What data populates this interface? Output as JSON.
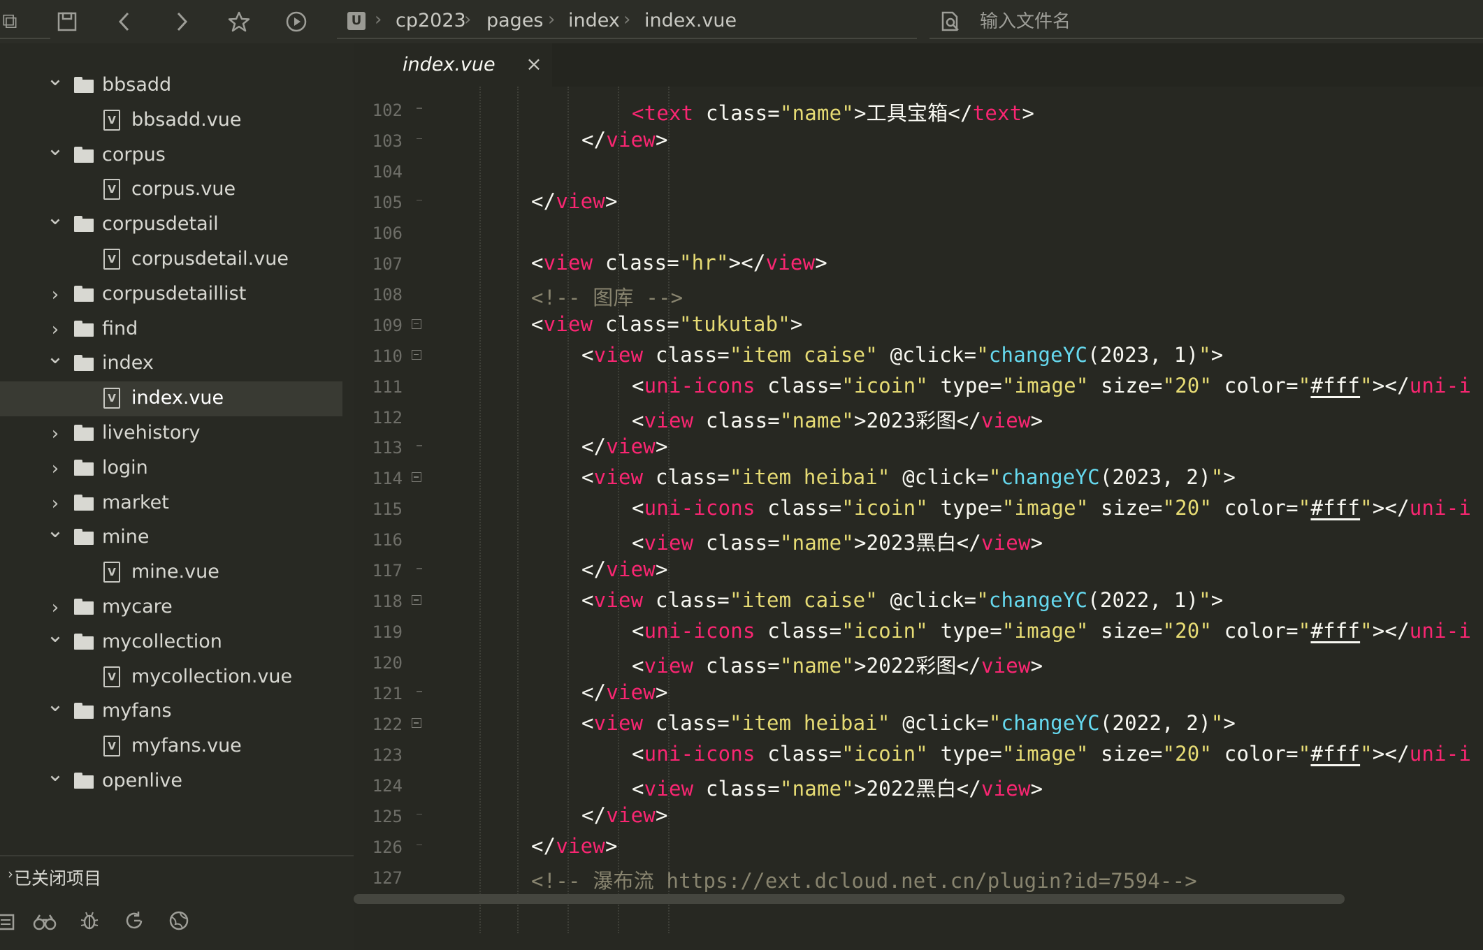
{
  "toolbar": {
    "search_placeholder": "输入文件名",
    "breadcrumb": [
      "cp2023",
      "pages",
      "index",
      "index.vue"
    ],
    "breadcrumb_logo": "U"
  },
  "sidebar": {
    "tree": [
      {
        "label": "bbsadd",
        "kind": "folder",
        "expanded": true,
        "depth": 0
      },
      {
        "label": "bbsadd.vue",
        "kind": "file",
        "depth": 1
      },
      {
        "label": "corpus",
        "kind": "folder",
        "expanded": true,
        "depth": 0
      },
      {
        "label": "corpus.vue",
        "kind": "file",
        "depth": 1
      },
      {
        "label": "corpusdetail",
        "kind": "folder",
        "expanded": true,
        "depth": 0
      },
      {
        "label": "corpusdetail.vue",
        "kind": "file",
        "depth": 1
      },
      {
        "label": "corpusdetaillist",
        "kind": "folder",
        "expanded": false,
        "depth": 0
      },
      {
        "label": "find",
        "kind": "folder",
        "expanded": false,
        "depth": 0
      },
      {
        "label": "index",
        "kind": "folder",
        "expanded": true,
        "depth": 0
      },
      {
        "label": "index.vue",
        "kind": "file",
        "depth": 1,
        "selected": true
      },
      {
        "label": "livehistory",
        "kind": "folder",
        "expanded": false,
        "depth": 0
      },
      {
        "label": "login",
        "kind": "folder",
        "expanded": false,
        "depth": 0
      },
      {
        "label": "market",
        "kind": "folder",
        "expanded": false,
        "depth": 0
      },
      {
        "label": "mine",
        "kind": "folder",
        "expanded": true,
        "depth": 0
      },
      {
        "label": "mine.vue",
        "kind": "file",
        "depth": 1
      },
      {
        "label": "mycare",
        "kind": "folder",
        "expanded": false,
        "depth": 0
      },
      {
        "label": "mycollection",
        "kind": "folder",
        "expanded": true,
        "depth": 0
      },
      {
        "label": "mycollection.vue",
        "kind": "file",
        "depth": 1
      },
      {
        "label": "myfans",
        "kind": "folder",
        "expanded": true,
        "depth": 0
      },
      {
        "label": "myfans.vue",
        "kind": "file",
        "depth": 1
      },
      {
        "label": "openlive",
        "kind": "folder",
        "expanded": true,
        "depth": 0
      }
    ],
    "closed_projects_label": "已关闭项目",
    "file_icon_letter": "V"
  },
  "editor": {
    "tab_label": "index.vue",
    "tab_close": "×",
    "lines": [
      {
        "n": "102",
        "fold": "end",
        "ind": 3,
        "tokens": [
          [
            "t",
            "<text"
          ],
          [
            "p",
            " "
          ],
          [
            "at",
            "class"
          ],
          [
            "p",
            "="
          ],
          [
            "s",
            "\"name\""
          ],
          [
            "p",
            ">工具宝箱</"
          ],
          [
            "t",
            "text"
          ],
          [
            "p",
            ">"
          ]
        ]
      },
      {
        "n": "103",
        "fold": "end",
        "ind": 2,
        "tokens": [
          [
            "p",
            "</"
          ],
          [
            "t",
            "view"
          ],
          [
            "p",
            ">"
          ]
        ]
      },
      {
        "n": "104",
        "fold": "",
        "ind": 0,
        "tokens": []
      },
      {
        "n": "105",
        "fold": "end",
        "ind": 1,
        "tokens": [
          [
            "p",
            "</"
          ],
          [
            "t",
            "view"
          ],
          [
            "p",
            ">"
          ]
        ]
      },
      {
        "n": "106",
        "fold": "",
        "ind": 0,
        "tokens": []
      },
      {
        "n": "107",
        "fold": "",
        "ind": 1,
        "tokens": [
          [
            "p",
            "<"
          ],
          [
            "t",
            "view"
          ],
          [
            "p",
            " "
          ],
          [
            "at",
            "class"
          ],
          [
            "p",
            "="
          ],
          [
            "s",
            "\"hr\""
          ],
          [
            "p",
            "></"
          ],
          [
            "t",
            "view"
          ],
          [
            "p",
            ">"
          ]
        ]
      },
      {
        "n": "108",
        "fold": "",
        "ind": 1,
        "tokens": [
          [
            "c",
            "<!-- 图库 -->"
          ]
        ]
      },
      {
        "n": "109",
        "fold": "open",
        "ind": 1,
        "tokens": [
          [
            "p",
            "<"
          ],
          [
            "t",
            "view"
          ],
          [
            "p",
            " "
          ],
          [
            "at",
            "class"
          ],
          [
            "p",
            "="
          ],
          [
            "s",
            "\"tukutab\""
          ],
          [
            "p",
            ">"
          ]
        ]
      },
      {
        "n": "110",
        "fold": "open",
        "ind": 2,
        "tokens": [
          [
            "p",
            "<"
          ],
          [
            "t",
            "view"
          ],
          [
            "p",
            " "
          ],
          [
            "at",
            "class"
          ],
          [
            "p",
            "="
          ],
          [
            "s",
            "\"item caise\""
          ],
          [
            "p",
            " "
          ],
          [
            "at",
            "@click"
          ],
          [
            "p",
            "="
          ],
          [
            "s",
            "\""
          ],
          [
            "f",
            "changeYC"
          ],
          [
            "p",
            "(2023, 1)"
          ],
          [
            "s",
            "\""
          ],
          [
            "p",
            ">"
          ]
        ]
      },
      {
        "n": "111",
        "fold": "",
        "ind": 3,
        "tokens": [
          [
            "p",
            "<"
          ],
          [
            "t",
            "uni-icons"
          ],
          [
            "p",
            " "
          ],
          [
            "at",
            "class"
          ],
          [
            "p",
            "="
          ],
          [
            "s",
            "\"icoin\""
          ],
          [
            "p",
            " "
          ],
          [
            "at",
            "type"
          ],
          [
            "p",
            "="
          ],
          [
            "s",
            "\"image\""
          ],
          [
            "p",
            " "
          ],
          [
            "at",
            "size"
          ],
          [
            "p",
            "="
          ],
          [
            "s",
            "\"20\""
          ],
          [
            "p",
            " "
          ],
          [
            "at",
            "color"
          ],
          [
            "p",
            "="
          ],
          [
            "s",
            "\""
          ],
          [
            "u",
            "#fff"
          ],
          [
            "s",
            "\""
          ],
          [
            "p",
            "></"
          ],
          [
            "t",
            "uni-i"
          ]
        ]
      },
      {
        "n": "112",
        "fold": "",
        "ind": 3,
        "tokens": [
          [
            "p",
            "<"
          ],
          [
            "t",
            "view"
          ],
          [
            "p",
            " "
          ],
          [
            "at",
            "class"
          ],
          [
            "p",
            "="
          ],
          [
            "s",
            "\"name\""
          ],
          [
            "p",
            ">2023彩图</"
          ],
          [
            "t",
            "view"
          ],
          [
            "p",
            ">"
          ]
        ]
      },
      {
        "n": "113",
        "fold": "end",
        "ind": 2,
        "tokens": [
          [
            "p",
            "</"
          ],
          [
            "t",
            "view"
          ],
          [
            "p",
            ">"
          ]
        ]
      },
      {
        "n": "114",
        "fold": "open",
        "ind": 2,
        "tokens": [
          [
            "p",
            "<"
          ],
          [
            "t",
            "view"
          ],
          [
            "p",
            " "
          ],
          [
            "at",
            "class"
          ],
          [
            "p",
            "="
          ],
          [
            "s",
            "\"item heibai\""
          ],
          [
            "p",
            " "
          ],
          [
            "at",
            "@click"
          ],
          [
            "p",
            "="
          ],
          [
            "s",
            "\""
          ],
          [
            "f",
            "changeYC"
          ],
          [
            "p",
            "(2023, 2)"
          ],
          [
            "s",
            "\""
          ],
          [
            "p",
            ">"
          ]
        ]
      },
      {
        "n": "115",
        "fold": "",
        "ind": 3,
        "tokens": [
          [
            "p",
            "<"
          ],
          [
            "t",
            "uni-icons"
          ],
          [
            "p",
            " "
          ],
          [
            "at",
            "class"
          ],
          [
            "p",
            "="
          ],
          [
            "s",
            "\"icoin\""
          ],
          [
            "p",
            " "
          ],
          [
            "at",
            "type"
          ],
          [
            "p",
            "="
          ],
          [
            "s",
            "\"image\""
          ],
          [
            "p",
            " "
          ],
          [
            "at",
            "size"
          ],
          [
            "p",
            "="
          ],
          [
            "s",
            "\"20\""
          ],
          [
            "p",
            " "
          ],
          [
            "at",
            "color"
          ],
          [
            "p",
            "="
          ],
          [
            "s",
            "\""
          ],
          [
            "u",
            "#fff"
          ],
          [
            "s",
            "\""
          ],
          [
            "p",
            "></"
          ],
          [
            "t",
            "uni-i"
          ]
        ]
      },
      {
        "n": "116",
        "fold": "",
        "ind": 3,
        "tokens": [
          [
            "p",
            "<"
          ],
          [
            "t",
            "view"
          ],
          [
            "p",
            " "
          ],
          [
            "at",
            "class"
          ],
          [
            "p",
            "="
          ],
          [
            "s",
            "\"name\""
          ],
          [
            "p",
            ">2023黑白</"
          ],
          [
            "t",
            "view"
          ],
          [
            "p",
            ">"
          ]
        ]
      },
      {
        "n": "117",
        "fold": "end",
        "ind": 2,
        "tokens": [
          [
            "p",
            "</"
          ],
          [
            "t",
            "view"
          ],
          [
            "p",
            ">"
          ]
        ]
      },
      {
        "n": "118",
        "fold": "open",
        "ind": 2,
        "tokens": [
          [
            "p",
            "<"
          ],
          [
            "t",
            "view"
          ],
          [
            "p",
            " "
          ],
          [
            "at",
            "class"
          ],
          [
            "p",
            "="
          ],
          [
            "s",
            "\"item caise\""
          ],
          [
            "p",
            " "
          ],
          [
            "at",
            "@click"
          ],
          [
            "p",
            "="
          ],
          [
            "s",
            "\""
          ],
          [
            "f",
            "changeYC"
          ],
          [
            "p",
            "(2022, 1)"
          ],
          [
            "s",
            "\""
          ],
          [
            "p",
            ">"
          ]
        ]
      },
      {
        "n": "119",
        "fold": "",
        "ind": 3,
        "tokens": [
          [
            "p",
            "<"
          ],
          [
            "t",
            "uni-icons"
          ],
          [
            "p",
            " "
          ],
          [
            "at",
            "class"
          ],
          [
            "p",
            "="
          ],
          [
            "s",
            "\"icoin\""
          ],
          [
            "p",
            " "
          ],
          [
            "at",
            "type"
          ],
          [
            "p",
            "="
          ],
          [
            "s",
            "\"image\""
          ],
          [
            "p",
            " "
          ],
          [
            "at",
            "size"
          ],
          [
            "p",
            "="
          ],
          [
            "s",
            "\"20\""
          ],
          [
            "p",
            " "
          ],
          [
            "at",
            "color"
          ],
          [
            "p",
            "="
          ],
          [
            "s",
            "\""
          ],
          [
            "u",
            "#fff"
          ],
          [
            "s",
            "\""
          ],
          [
            "p",
            "></"
          ],
          [
            "t",
            "uni-i"
          ]
        ]
      },
      {
        "n": "120",
        "fold": "",
        "ind": 3,
        "tokens": [
          [
            "p",
            "<"
          ],
          [
            "t",
            "view"
          ],
          [
            "p",
            " "
          ],
          [
            "at",
            "class"
          ],
          [
            "p",
            "="
          ],
          [
            "s",
            "\"name\""
          ],
          [
            "p",
            ">2022彩图</"
          ],
          [
            "t",
            "view"
          ],
          [
            "p",
            ">"
          ]
        ]
      },
      {
        "n": "121",
        "fold": "end",
        "ind": 2,
        "tokens": [
          [
            "p",
            "</"
          ],
          [
            "t",
            "view"
          ],
          [
            "p",
            ">"
          ]
        ]
      },
      {
        "n": "122",
        "fold": "open",
        "ind": 2,
        "tokens": [
          [
            "p",
            "<"
          ],
          [
            "t",
            "view"
          ],
          [
            "p",
            " "
          ],
          [
            "at",
            "class"
          ],
          [
            "p",
            "="
          ],
          [
            "s",
            "\"item heibai\""
          ],
          [
            "p",
            " "
          ],
          [
            "at",
            "@click"
          ],
          [
            "p",
            "="
          ],
          [
            "s",
            "\""
          ],
          [
            "f",
            "changeYC"
          ],
          [
            "p",
            "(2022, 2)"
          ],
          [
            "s",
            "\""
          ],
          [
            "p",
            ">"
          ]
        ]
      },
      {
        "n": "123",
        "fold": "",
        "ind": 3,
        "tokens": [
          [
            "p",
            "<"
          ],
          [
            "t",
            "uni-icons"
          ],
          [
            "p",
            " "
          ],
          [
            "at",
            "class"
          ],
          [
            "p",
            "="
          ],
          [
            "s",
            "\"icoin\""
          ],
          [
            "p",
            " "
          ],
          [
            "at",
            "type"
          ],
          [
            "p",
            "="
          ],
          [
            "s",
            "\"image\""
          ],
          [
            "p",
            " "
          ],
          [
            "at",
            "size"
          ],
          [
            "p",
            "="
          ],
          [
            "s",
            "\"20\""
          ],
          [
            "p",
            " "
          ],
          [
            "at",
            "color"
          ],
          [
            "p",
            "="
          ],
          [
            "s",
            "\""
          ],
          [
            "u",
            "#fff"
          ],
          [
            "s",
            "\""
          ],
          [
            "p",
            "></"
          ],
          [
            "t",
            "uni-i"
          ]
        ]
      },
      {
        "n": "124",
        "fold": "",
        "ind": 3,
        "tokens": [
          [
            "p",
            "<"
          ],
          [
            "t",
            "view"
          ],
          [
            "p",
            " "
          ],
          [
            "at",
            "class"
          ],
          [
            "p",
            "="
          ],
          [
            "s",
            "\"name\""
          ],
          [
            "p",
            ">2022黑白</"
          ],
          [
            "t",
            "view"
          ],
          [
            "p",
            ">"
          ]
        ]
      },
      {
        "n": "125",
        "fold": "end",
        "ind": 2,
        "tokens": [
          [
            "p",
            "</"
          ],
          [
            "t",
            "view"
          ],
          [
            "p",
            ">"
          ]
        ]
      },
      {
        "n": "126",
        "fold": "end",
        "ind": 1,
        "tokens": [
          [
            "p",
            "</"
          ],
          [
            "t",
            "view"
          ],
          [
            "p",
            ">"
          ]
        ]
      },
      {
        "n": "127",
        "fold": "",
        "ind": 1,
        "tokens": [
          [
            "c",
            "<!-- 瀑布流 https://ext.dcloud.net.cn/plugin?id=7594-->"
          ]
        ]
      }
    ]
  },
  "colors": {
    "background": "#272822",
    "tag": "#f92672",
    "string": "#e6db74",
    "function": "#66d9ef",
    "comment": "#88846f"
  }
}
